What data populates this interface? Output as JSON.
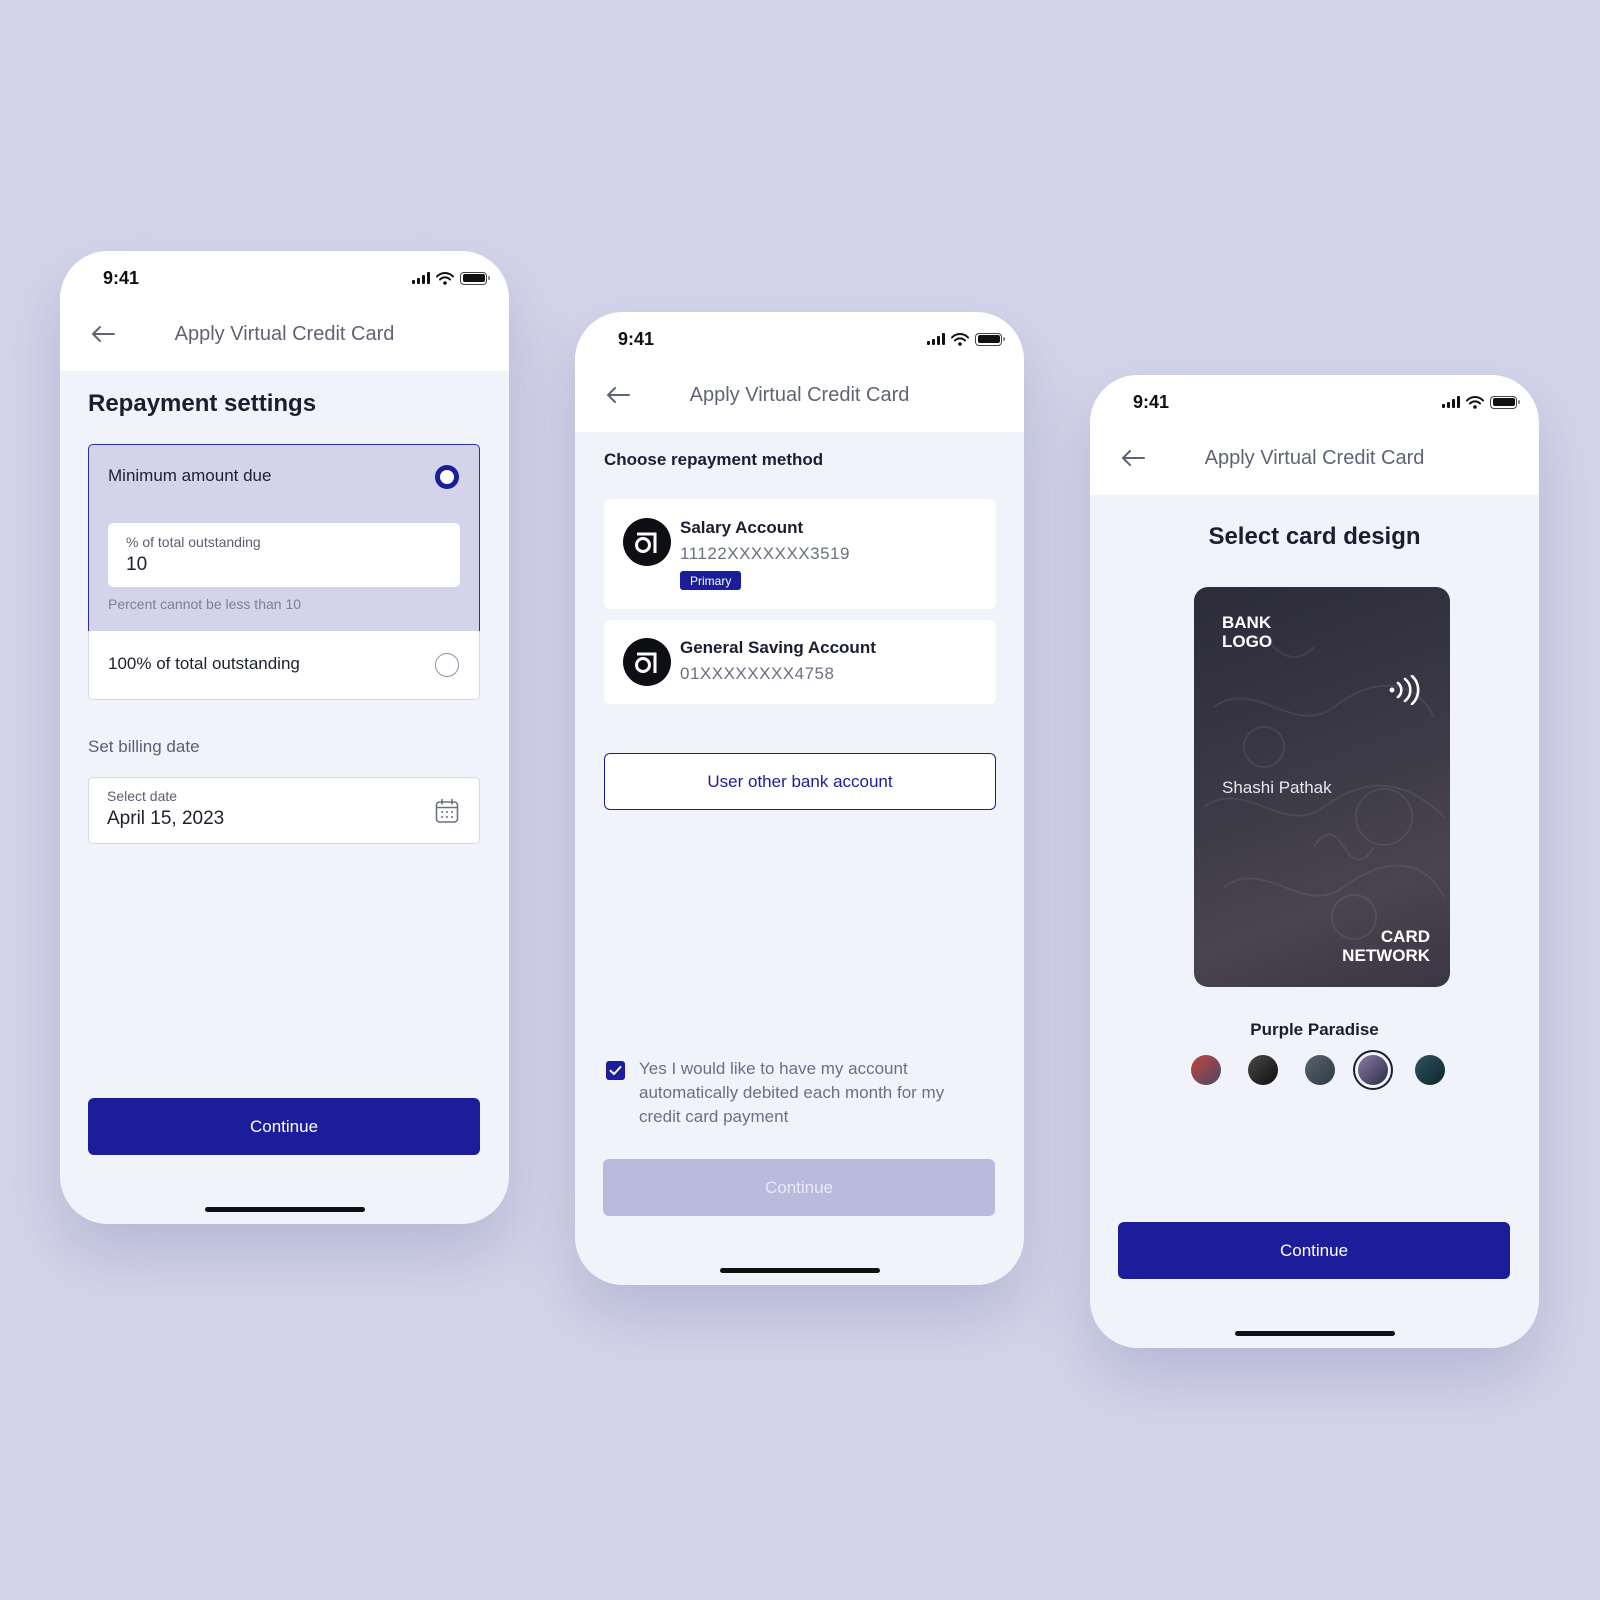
{
  "screens": [
    {
      "status_time": "9:41",
      "nav_title": "Apply Virtual Credit Card",
      "section_title": "Repayment settings",
      "options": [
        {
          "label": "Minimum amount due",
          "selected": true
        },
        {
          "label": "100% of total outstanding",
          "selected": false
        }
      ],
      "percent_field": {
        "caption": "% of total outstanding",
        "value": "10",
        "helper": "Percent cannot be less than 10"
      },
      "billing": {
        "label": "Set billing date",
        "caption": "Select date",
        "value": "April 15, 2023"
      },
      "continue_label": "Continue"
    },
    {
      "status_time": "9:41",
      "nav_title": "Apply Virtual Credit Card",
      "section_title": "Choose repayment method",
      "accounts": [
        {
          "name": "Salary Account",
          "number": "11122XXXXXXX3519",
          "badge": "Primary"
        },
        {
          "name": "General Saving Account",
          "number": "01XXXXXXXX4758"
        }
      ],
      "other_account_label": "User other bank account",
      "autodebit": {
        "checked": true,
        "text": "Yes I would like to have my account automatically debited each month for my credit card payment"
      },
      "continue_label": "Continue"
    },
    {
      "status_time": "9:41",
      "nav_title": "Apply Virtual Credit Card",
      "section_title": "Select card design",
      "card": {
        "bank_logo": "BANK LOGO",
        "holder": "Shashi Pathak",
        "network": "CARD NETWORK"
      },
      "selected_design": "Purple Paradise",
      "swatches": [
        {
          "from": "#c4433b",
          "to": "#4b4a6a"
        },
        {
          "from": "#4a4a4a",
          "to": "#0e0e0e"
        },
        {
          "from": "#59646f",
          "to": "#2f3942"
        },
        {
          "from": "#8a7aa8",
          "to": "#2c2b45",
          "selected": true
        },
        {
          "from": "#2d5560",
          "to": "#10242b"
        }
      ],
      "continue_label": "Continue"
    }
  ],
  "icons": {
    "back": "arrow-left-icon",
    "signal": "cellular-signal-icon",
    "wifi": "wifi-icon",
    "battery": "battery-icon",
    "calendar": "calendar-icon",
    "bank": "bank-logo-icon",
    "nfc": "contactless-icon",
    "check": "checkmark-icon"
  },
  "colors": {
    "background": "#d3d4e9",
    "primary": "#1c1d9a",
    "primary_disabled": "#b8bade",
    "surface": "#f1f3fb",
    "selected_option": "#d3d4ea"
  }
}
